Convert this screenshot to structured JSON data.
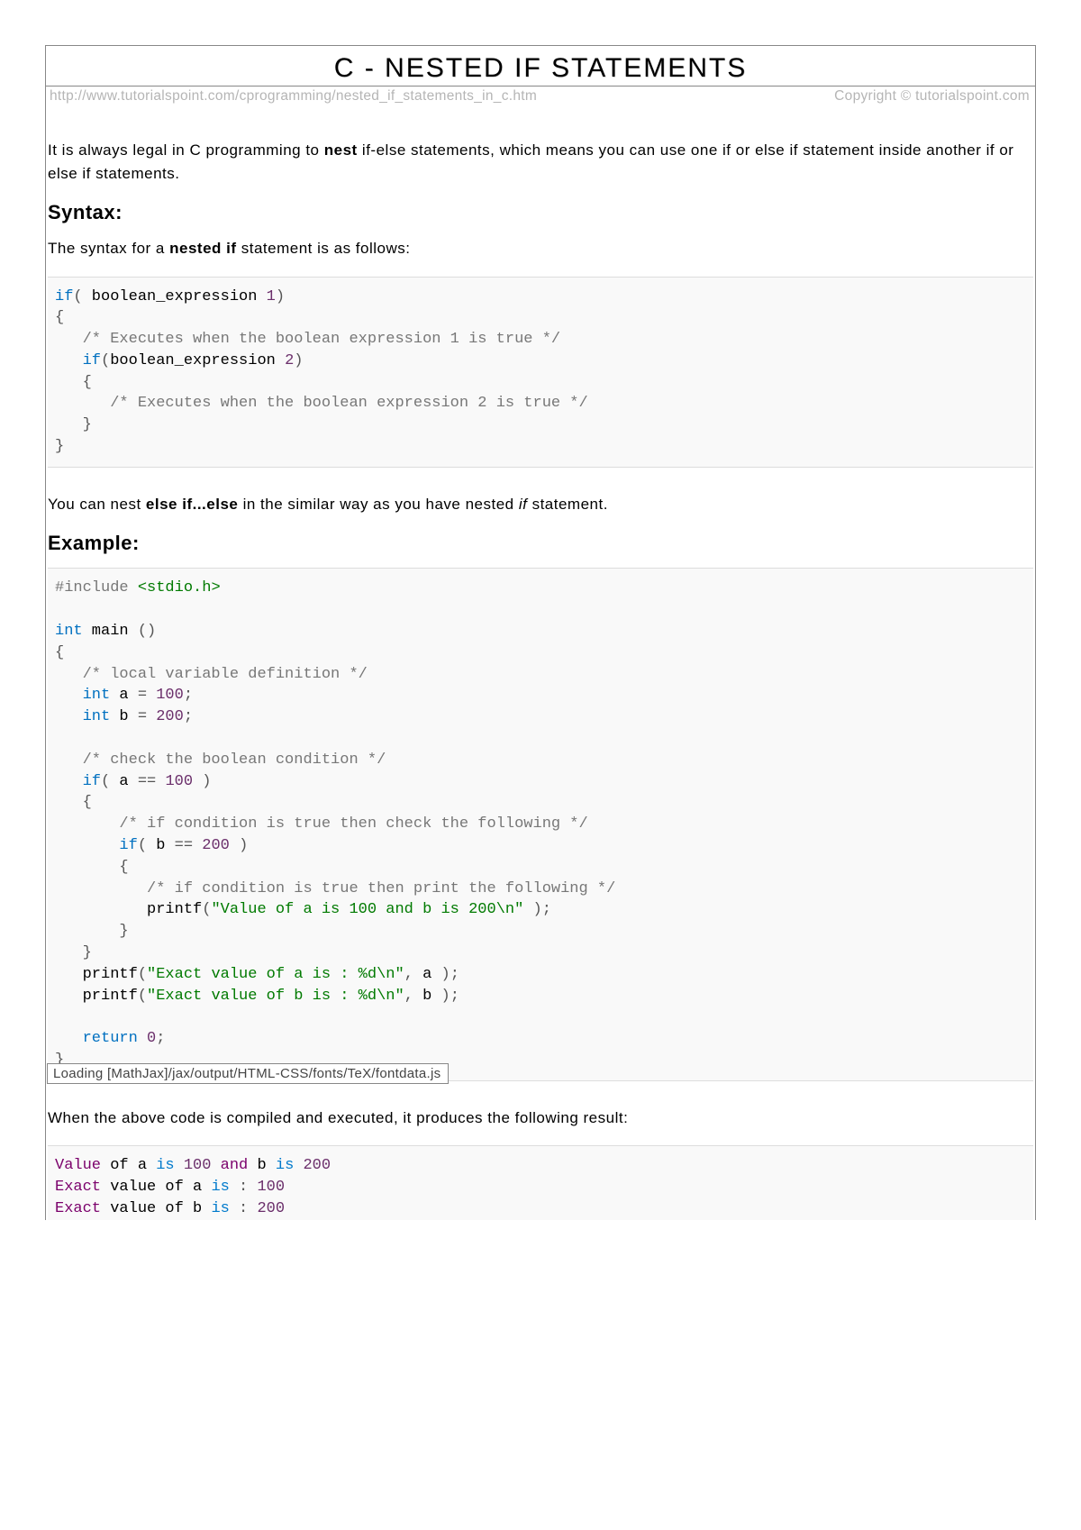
{
  "title": "C - NESTED IF STATEMENTS",
  "source_url": "http://www.tutorialspoint.com/cprogramming/nested_if_statements_in_c.htm",
  "copyright": "Copyright © tutorialspoint.com",
  "intro_pre": "It is always legal in C programming to ",
  "intro_bold": "nest",
  "intro_post": " if-else statements, which means you can use one if or else if statement inside another if or else if statements.",
  "syntax_heading": "Syntax:",
  "syntax_lead_pre": "The syntax for a ",
  "syntax_lead_bold": "nested if",
  "syntax_lead_post": " statement is as follows:",
  "code_syntax": "if( boolean_expression 1)\n{\n   /* Executes when the boolean expression 1 is true */\n   if(boolean_expression 2)\n   {\n      /* Executes when the boolean expression 2 is true */\n   }\n}",
  "nest_else_pre": "You can nest ",
  "nest_else_bold": "else if...else",
  "nest_else_mid": " in the similar way as you have nested ",
  "nest_else_it": "if",
  "nest_else_post": " statement.",
  "example_heading": "Example:",
  "code_example": "#include <stdio.h>\n \nint main ()\n{\n   /* local variable definition */\n   int a = 100;\n   int b = 200;\n \n   /* check the boolean condition */\n   if( a == 100 )\n   {\n       /* if condition is true then check the following */\n       if( b == 200 )\n       {\n          /* if condition is true then print the following */\n          printf(\"Value of a is 100 and b is 200\\n\" );\n       }\n   }\n   printf(\"Exact value of a is : %d\\n\", a );\n   printf(\"Exact value of b is : %d\\n\", b );\n \n   return 0;\n}",
  "result_lead": "When the above code is compiled and executed, it produces the following result:",
  "code_output": "Value of a is 100 and b is 200\nExact value of a is : 100\nExact value of b is : 200",
  "mathjax_status": "Loading [MathJax]/jax/output/HTML-CSS/fonts/TeX/fontdata.js"
}
